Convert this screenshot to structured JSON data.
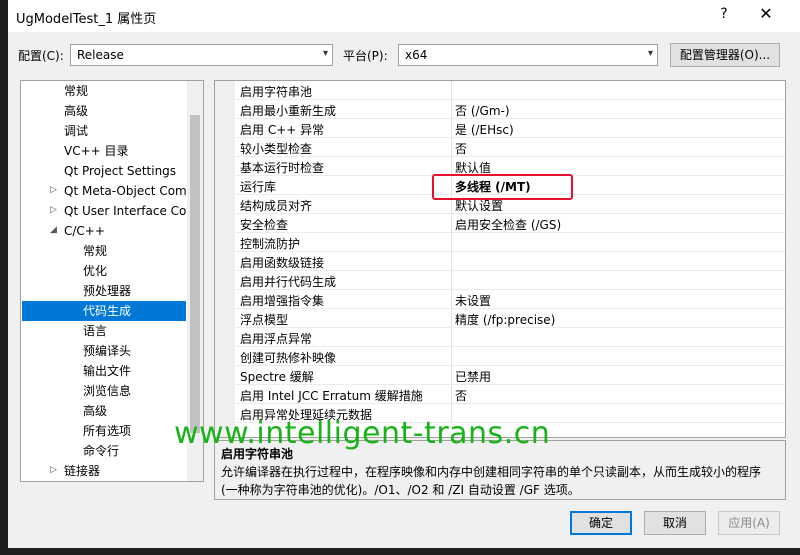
{
  "window": {
    "title": "UgModelTest_1 属性页",
    "help_label": "?",
    "close_label": "✕"
  },
  "toolbar": {
    "config_label": "配置(C):",
    "config_value": "Release",
    "platform_label": "平台(P):",
    "platform_value": "x64",
    "config_manager_label": "配置管理器(O)..."
  },
  "tree": {
    "items": [
      {
        "label": "常规"
      },
      {
        "label": "高级"
      },
      {
        "label": "调试"
      },
      {
        "label": "VC++ 目录"
      },
      {
        "label": "Qt Project Settings"
      },
      {
        "label": "Qt Meta-Object Com"
      },
      {
        "label": "Qt User Interface Co"
      },
      {
        "label": "C/C++"
      },
      {
        "label": "常规"
      },
      {
        "label": "优化"
      },
      {
        "label": "预处理器"
      },
      {
        "label": "代码生成"
      },
      {
        "label": "语言"
      },
      {
        "label": "预编译头"
      },
      {
        "label": "输出文件"
      },
      {
        "label": "浏览信息"
      },
      {
        "label": "高级"
      },
      {
        "label": "所有选项"
      },
      {
        "label": "命令行"
      },
      {
        "label": "链接器"
      }
    ]
  },
  "properties": {
    "rows": [
      {
        "name": "启用字符串池",
        "value": ""
      },
      {
        "name": "启用最小重新生成",
        "value": "否 (/Gm-)"
      },
      {
        "name": "启用 C++ 异常",
        "value": "是 (/EHsc)"
      },
      {
        "name": "较小类型检查",
        "value": "否"
      },
      {
        "name": "基本运行时检查",
        "value": "默认值"
      },
      {
        "name": "运行库",
        "value": "多线程 (/MT)"
      },
      {
        "name": "结构成员对齐",
        "value": "默认设置"
      },
      {
        "name": "安全检查",
        "value": "启用安全检查 (/GS)"
      },
      {
        "name": "控制流防护",
        "value": ""
      },
      {
        "name": "启用函数级链接",
        "value": ""
      },
      {
        "name": "启用并行代码生成",
        "value": ""
      },
      {
        "name": "启用增强指令集",
        "value": "未设置"
      },
      {
        "name": "浮点模型",
        "value": "精度 (/fp:precise)"
      },
      {
        "name": "启用浮点异常",
        "value": ""
      },
      {
        "name": "创建可热修补映像",
        "value": ""
      },
      {
        "name": "Spectre 缓解",
        "value": "已禁用"
      },
      {
        "name": "启用 Intel JCC Erratum 缓解措施",
        "value": "否"
      },
      {
        "name": "启用异常处理延续元数据",
        "value": ""
      }
    ]
  },
  "description": {
    "title": "启用字符串池",
    "text": "允许编译器在执行过程中，在程序映像和内存中创建相同字符串的单个只读副本，从而生成较小的程序(一种称为字符串池的优化)。/O1、/O2 和 /ZI 自动设置 /GF 选项。"
  },
  "watermark": "www.intelligent-trans.cn",
  "buttons": {
    "ok": "确定",
    "cancel": "取消",
    "apply": "应用(A)"
  },
  "colors": {
    "selection": "#0078d7",
    "highlight_box": "#e8112d",
    "watermark": "#17b317"
  }
}
